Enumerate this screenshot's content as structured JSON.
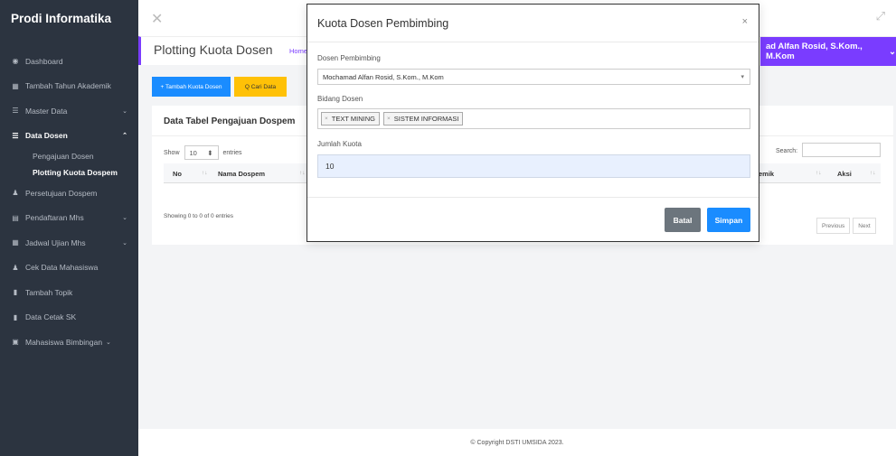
{
  "sidebar": {
    "brand": "Prodi Informatika",
    "items": [
      {
        "label": "Dashboard",
        "icon": "dashboard-icon"
      },
      {
        "label": "Tambah Tahun Akademik",
        "icon": "calendar-icon"
      },
      {
        "label": "Master Data",
        "icon": "list-icon"
      },
      {
        "label": "Data Dosen",
        "icon": "list-icon"
      },
      {
        "label": "Persetujuan Dospem",
        "icon": "user-check-icon"
      },
      {
        "label": "Pendaftaran Mhs",
        "icon": "id-card-icon"
      },
      {
        "label": "Jadwal Ujian Mhs",
        "icon": "calendar-icon"
      },
      {
        "label": "Cek Data Mahasiswa",
        "icon": "users-icon"
      },
      {
        "label": "Tambah Topik",
        "icon": "file-icon"
      },
      {
        "label": "Data Cetak SK",
        "icon": "file-icon"
      },
      {
        "label": "Mahasiswa Bimbingan",
        "icon": "card-icon"
      }
    ],
    "subitems": [
      "Pengajuan Dosen",
      "Plotting Kuota Dospem"
    ]
  },
  "header": {
    "title": "Plotting Kuota Dosen",
    "breadcrumb": "Home /",
    "user": "ad Alfan Rosid, S.Kom., M.Kom"
  },
  "actions": {
    "add": "+ Tambah Kuota Dosen",
    "search": "Q Cari Data"
  },
  "table": {
    "title": "Data Tabel Pengajuan Dospem",
    "show": "Show",
    "entries_value": "10",
    "entries": "entries",
    "search_label": "Search:",
    "col_no": "No",
    "col_name": "Nama Dospem",
    "col_akademik": "emik",
    "col_aksi": "Aksi",
    "info": "Showing 0 to 0 of 0 entries",
    "prev": "Previous",
    "next": "Next"
  },
  "modal": {
    "title": "Kuota Dosen Pembimbing",
    "close": "×",
    "label_dosen": "Dosen Pembimbing",
    "dosen_value": "Mochamad Alfan Rosid, S.Kom., M.Kom",
    "label_bidang": "Bidang Dosen",
    "tags": [
      "TEXT MINING",
      "SISTEM INFORMASI"
    ],
    "label_kuota": "Jumlah Kuota",
    "kuota_value": "10",
    "cancel": "Batal",
    "save": "Simpan"
  },
  "footer": "© Copyright DSTI UMSIDA 2023."
}
